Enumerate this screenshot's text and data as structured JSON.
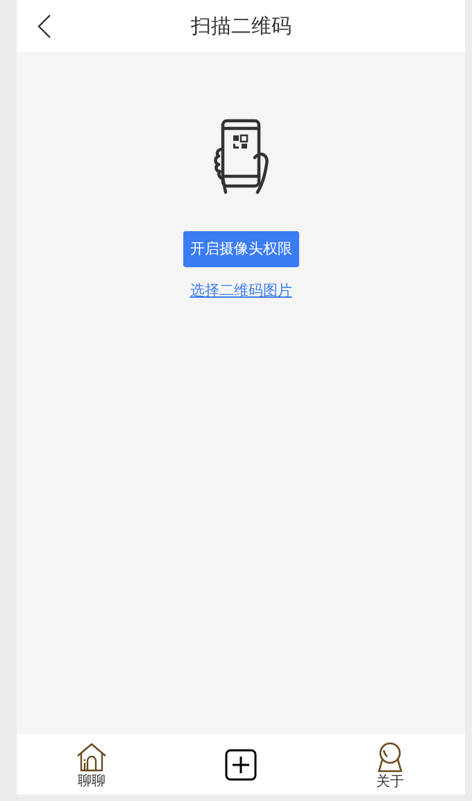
{
  "header": {
    "title": "扫描二维码"
  },
  "main": {
    "permission_button": "开启摄像头权限",
    "pick_image_link": "选择二维码图片"
  },
  "tabbar": [
    {
      "kind": "home",
      "label": "聊聊"
    },
    {
      "kind": "add"
    },
    {
      "kind": "about",
      "label": "关于"
    }
  ]
}
